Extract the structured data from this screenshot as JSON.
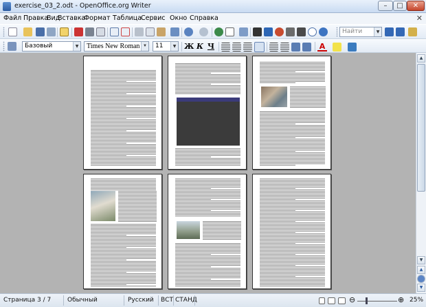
{
  "window": {
    "title": "exercise_03_2.odt - OpenOffice.org Writer",
    "minimize": "–",
    "maximize": "□",
    "close": "✕"
  },
  "menu": [
    "Файл",
    "Правка",
    "Вид",
    "Вставка",
    "Формат",
    "Таблица",
    "Сервис",
    "Окно",
    "Справка"
  ],
  "menu_close": "✕",
  "toolbar": {
    "find_placeholder": "Найти"
  },
  "format": {
    "style": "Базовый",
    "font": "Times New Roman",
    "size": "11",
    "bold": "Ж",
    "italic": "К",
    "underline": "Ч",
    "font_color_glyph": "A"
  },
  "status": {
    "page": "Страница  3 / 7",
    "style": "Обычный",
    "language": "Русский",
    "insert_mode": "ВСТ",
    "selection_mode": "СТАНД",
    "zoom": "25%"
  },
  "colors": {
    "accent": "#2a5aa0",
    "table_header": "#3b3b7a"
  }
}
